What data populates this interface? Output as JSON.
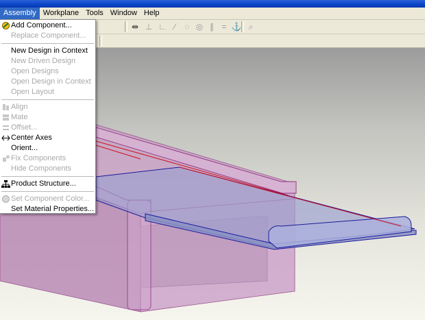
{
  "menubar": {
    "items": [
      {
        "label": "Assembly",
        "active": true
      },
      {
        "label": "Workplane",
        "active": false
      },
      {
        "label": "Tools",
        "active": false
      },
      {
        "label": "Window",
        "active": false
      },
      {
        "label": "Help",
        "active": false
      }
    ]
  },
  "assembly_menu": {
    "groups": [
      [
        {
          "label": "Add Component...",
          "enabled": true,
          "icon": "add-component-icon"
        },
        {
          "label": "Replace Component...",
          "enabled": false,
          "icon": ""
        }
      ],
      [
        {
          "label": "New Design in Context",
          "enabled": true,
          "icon": ""
        },
        {
          "label": "New Driven Design",
          "enabled": false,
          "icon": ""
        },
        {
          "label": "Open Designs",
          "enabled": false,
          "icon": ""
        },
        {
          "label": "Open Design in Context",
          "enabled": false,
          "icon": ""
        },
        {
          "label": "Open Layout",
          "enabled": false,
          "icon": ""
        }
      ],
      [
        {
          "label": "Align",
          "enabled": false,
          "icon": "align-icon"
        },
        {
          "label": "Mate",
          "enabled": false,
          "icon": "mate-icon"
        },
        {
          "label": "Offset...",
          "enabled": false,
          "icon": "offset-icon"
        },
        {
          "label": "Center Axes",
          "enabled": true,
          "icon": "center-axes-icon"
        },
        {
          "label": "Orient...",
          "enabled": true,
          "icon": ""
        },
        {
          "label": "Fix Components",
          "enabled": false,
          "icon": "fix-components-icon"
        },
        {
          "label": "Hide Components",
          "enabled": false,
          "icon": ""
        }
      ],
      [
        {
          "label": "Product Structure...",
          "enabled": true,
          "icon": "product-structure-icon"
        }
      ],
      [
        {
          "label": "Set Component Color...",
          "enabled": false,
          "icon": "component-color-icon"
        },
        {
          "label": "Set Material Properties...",
          "enabled": true,
          "icon": ""
        }
      ]
    ]
  },
  "toolbar": {
    "icons": [
      "dimension-tool-icon",
      "constraint-icon",
      "perpendicular-icon",
      "line-icon",
      "tangent-icon",
      "concentric-icon",
      "parallel-icon",
      "equal-icon",
      "fix-icon",
      "search-icon"
    ]
  },
  "colors": {
    "menu_highlight": "#316ac5",
    "titlebar": "#0a46c8",
    "body_solid": "#b080ae",
    "tray_solid": "#9aa0c8",
    "edge_blue": "#1a1a9a",
    "edge_red": "#d01020"
  }
}
